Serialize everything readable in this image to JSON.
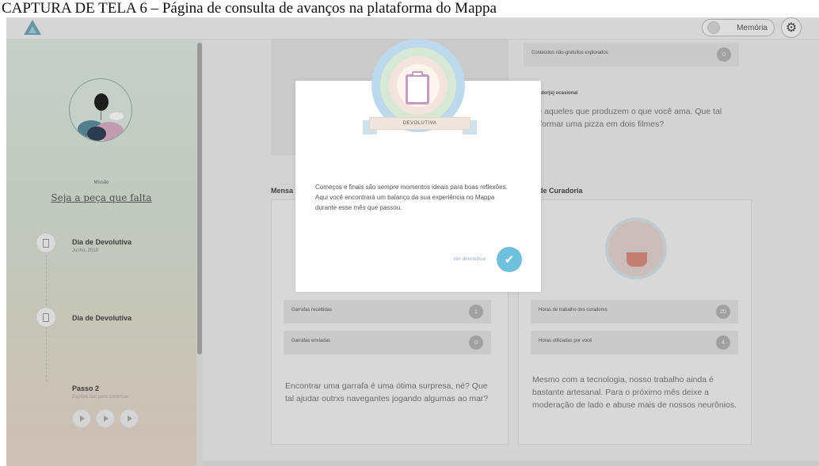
{
  "caption": "CAPTURA DE TELA 6 – Página de consulta de avanços na plataforma do Mappa",
  "header": {
    "memoria_label": "Memória",
    "gear_icon": "gear-icon",
    "logo_icon": "mappa-logo-icon"
  },
  "sidebar": {
    "mission_label": "Missão",
    "mission_title": "Seja a peça que falta",
    "timeline": [
      {
        "title": "Dia de Devolutiva",
        "subtitle": "Junho, 2018"
      },
      {
        "title": "Dia de Devolutiva",
        "subtitle": ""
      }
    ],
    "step": {
      "title": "Passo 2",
      "subtitle": "Explore isto para continuar"
    }
  },
  "main": {
    "top_right_stat": {
      "label": "Conteúdos não-gratuitos explorados",
      "value": "0"
    },
    "top_right_heading": "midor(a) ocasional",
    "top_right_text_1": "le aqueles que produzem o que você ama. Que tal",
    "top_right_text_2": "sformar uma pizza em dois filmes?",
    "left_section_title": "Mensa",
    "right_section_title": "de Curadoria",
    "left_stats": [
      {
        "label": "Garrafas recebidas",
        "value": "1"
      },
      {
        "label": "Garrafas enviadas",
        "value": "0"
      }
    ],
    "right_stats": [
      {
        "label": "Horas de trabalho dxs curadorxs",
        "value": "20"
      },
      {
        "label": "Horas utilizadas por você",
        "value": "4"
      }
    ],
    "left_text_1": "Encontrar uma garrafa é uma ótima surpresa, né? Que",
    "left_text_2": "tal ajudar outrxs navegantes jogando algumas ao mar?",
    "right_text_1": "Mesmo com a tecnologia, nosso trabalho ainda é",
    "right_text_2": "bastante artesanal. Para o próximo mês deixe a",
    "right_text_3": "moderação de lado e abuse mais de nossos neurônios."
  },
  "modal": {
    "badge_label": "DEVOLUTIVA",
    "line_1": "Começos e finais são sempre momentos ideais para boas reflexões.",
    "line_2": "Aqui você encontrará um balanço da sua experiência no Mappa",
    "line_3": "durante esse mês que passou.",
    "link_label": "Ver devolutiva",
    "check_icon": "✔"
  },
  "colors": {
    "accent": "#6fc0dc",
    "badge_ring": "#bed8ec",
    "clipboard": "#c59cc1"
  }
}
